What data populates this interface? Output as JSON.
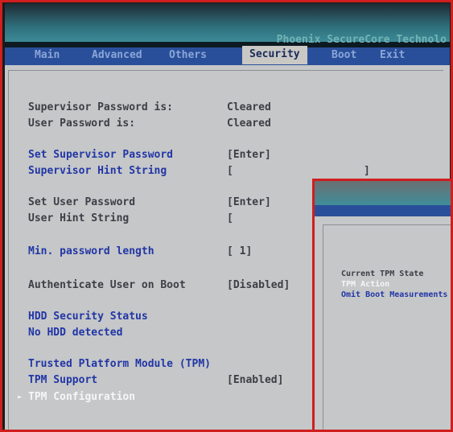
{
  "vendor": "Phoenix SecureCore Technolo",
  "tabs": [
    "Main",
    "Advanced",
    "Others",
    "Security",
    "Boot",
    "Exit"
  ],
  "active_tab": "Security",
  "security": {
    "supervisor_password_label": "Supervisor Password is:",
    "supervisor_password_value": "Cleared",
    "user_password_label": "User Password is:",
    "user_password_value": "Cleared",
    "set_supervisor_password_label": "Set Supervisor Password",
    "set_supervisor_password_value": "[Enter]",
    "supervisor_hint_label": "Supervisor Hint String",
    "supervisor_hint_open": "[",
    "supervisor_hint_close": "]",
    "set_user_password_label": "Set User Password",
    "set_user_password_value": "[Enter]",
    "user_hint_label": "User Hint String",
    "user_hint_open": "[",
    "min_password_length_label": "Min. password length",
    "min_password_length_value": "[ 1]",
    "authenticate_label": "Authenticate User on Boot",
    "authenticate_value": "[Disabled]",
    "hdd_security_label": "HDD Security Status",
    "no_hdd_label": "No HDD detected",
    "tpm_heading": "Trusted Platform Module (TPM)",
    "tpm_support_label": "TPM Support",
    "tpm_support_value": "[Enabled]",
    "tpm_config_label": "TPM Configuration"
  },
  "overlay": {
    "current_state_label": "Current TPM State",
    "tpm_action_label": "TPM Action",
    "omit_boot_label": "Omit Boot Measurements"
  },
  "colors": {
    "selected_tab_bg": "#c9c8c4",
    "blue_item": "#2236a6",
    "panel_bg": "#c5c7c8",
    "tabbar": "#2a4f9a"
  }
}
